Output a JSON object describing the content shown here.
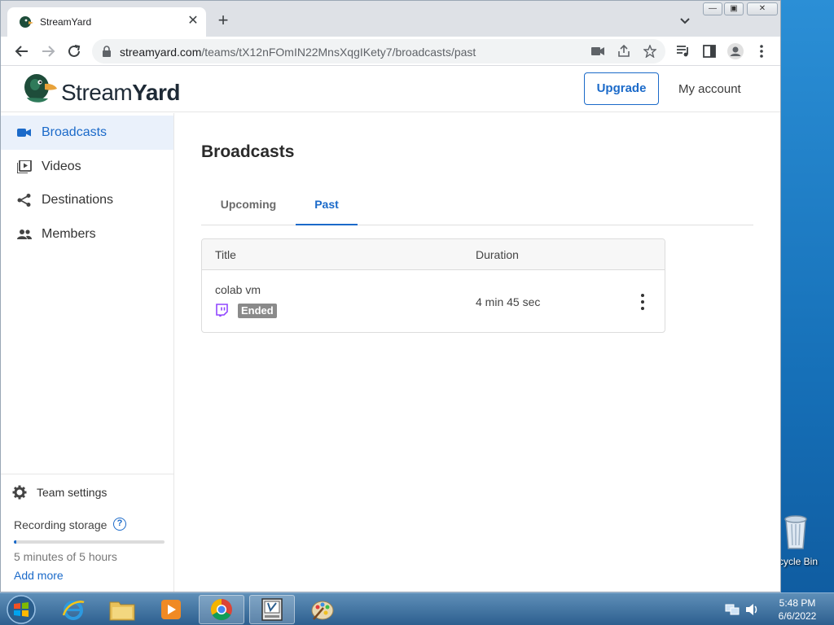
{
  "browser": {
    "tab_title": "StreamYard",
    "url_host": "streamyard.com",
    "url_path": "/teams/tX12nFOmIN22MnsXqgIKety7/broadcasts/past"
  },
  "header": {
    "logo_regular": "Stream",
    "logo_bold": "Yard",
    "upgrade_label": "Upgrade",
    "account_label": "My account"
  },
  "sidebar": {
    "items": [
      {
        "label": "Broadcasts",
        "icon": "video-camera-icon",
        "active": true
      },
      {
        "label": "Videos",
        "icon": "video-library-icon",
        "active": false
      },
      {
        "label": "Destinations",
        "icon": "share-icon",
        "active": false
      },
      {
        "label": "Members",
        "icon": "people-icon",
        "active": false
      }
    ],
    "team_settings_label": "Team settings",
    "storage_label": "Recording storage",
    "storage_help": "?",
    "storage_used_fraction": 0.017,
    "storage_text": "5 minutes of 5 hours",
    "add_more_label": "Add more"
  },
  "main": {
    "title": "Broadcasts",
    "tabs": [
      {
        "label": "Upcoming",
        "active": false
      },
      {
        "label": "Past",
        "active": true
      }
    ],
    "table": {
      "columns": [
        "Title",
        "Duration"
      ],
      "rows": [
        {
          "title": "colab vm",
          "platform_icon": "twitch-icon",
          "status": "Ended",
          "duration": "4 min 45 sec"
        }
      ]
    }
  },
  "desktop": {
    "recycle_bin_label": "cycle Bin"
  },
  "taskbar": {
    "time": "5:48 PM",
    "date": "6/6/2022"
  },
  "colors": {
    "accent": "#1b6ac9",
    "active_nav_bg": "#eaf1fb",
    "badge_bg": "#8a8a8a",
    "twitch": "#9146ff"
  }
}
